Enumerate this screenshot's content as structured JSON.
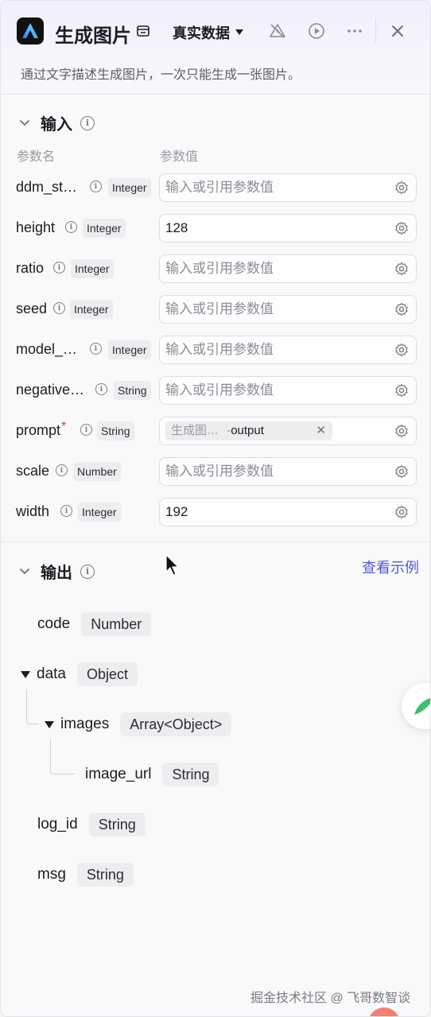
{
  "header": {
    "title": "生成图片",
    "data_source": "真实数据",
    "description": "通过文字描述生成图片，一次只能生成一张图片。"
  },
  "input_section": {
    "title": "输入",
    "col_name": "参数名",
    "col_value": "参数值",
    "params": [
      {
        "name": "ddm_st…",
        "type": "Integer",
        "value": "输入或引用参数值",
        "placeholder": true
      },
      {
        "name": "height",
        "type": "Integer",
        "value": "128",
        "placeholder": false
      },
      {
        "name": "ratio",
        "type": "Integer",
        "value": "输入或引用参数值",
        "placeholder": true
      },
      {
        "name": "seed",
        "type": "Integer",
        "value": "输入或引用参数值",
        "placeholder": true
      },
      {
        "name": "model_…",
        "type": "Integer",
        "value": "输入或引用参数值",
        "placeholder": true
      },
      {
        "name": "negative…",
        "type": "String",
        "value": "输入或引用参数值",
        "placeholder": true
      },
      {
        "name": "prompt",
        "required": "*",
        "type": "String",
        "ref_source": "生成图…",
        "ref_sep": "-",
        "ref_output": "output"
      },
      {
        "name": "scale",
        "type": "Number",
        "value": "输入或引用参数值",
        "placeholder": true
      },
      {
        "name": "width",
        "type": "Integer",
        "value": "192",
        "placeholder": false
      }
    ]
  },
  "output_section": {
    "title": "输出",
    "view_example": "查看示例",
    "fields": [
      {
        "name": "code",
        "type": "Number"
      },
      {
        "name": "data",
        "type": "Object"
      },
      {
        "name": "images",
        "type": "Array<Object>"
      },
      {
        "name": "image_url",
        "type": "String"
      },
      {
        "name": "log_id",
        "type": "String"
      },
      {
        "name": "msg",
        "type": "String"
      }
    ]
  },
  "watermark": "掘金技术社区 @ 飞哥数智谈",
  "colors": {
    "accent": "#4f59d6",
    "required": "#e03b3b",
    "header_tint": "#f1effc"
  }
}
